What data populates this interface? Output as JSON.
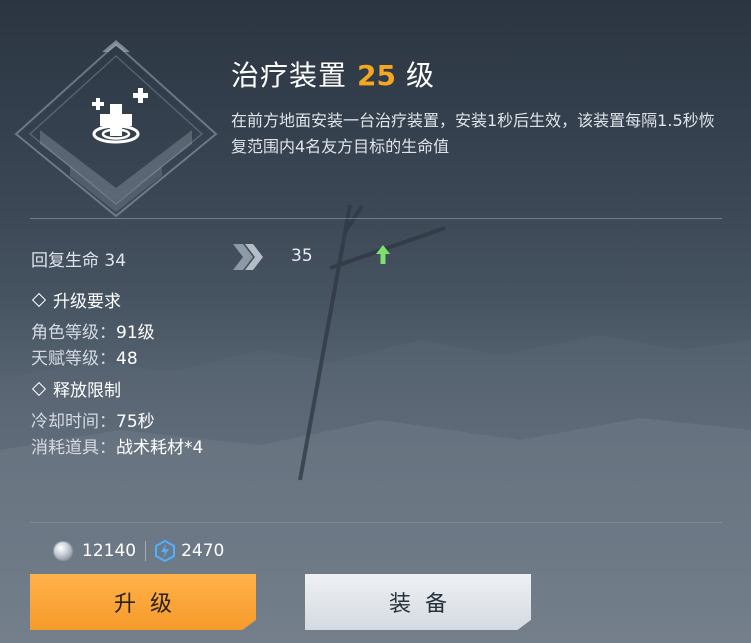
{
  "skill": {
    "name": "治疗装置",
    "level": "25",
    "level_suffix": "级",
    "description": "在前方地面安装一台治疗装置，安装1秒后生效，该装置每隔1.5秒恢复范围内4名友方目标的生命值",
    "icon": "healing-device-icon"
  },
  "stat": {
    "label": "回复生命 34",
    "next_value": "35"
  },
  "requirements": {
    "header": "升级要求",
    "items": [
      {
        "key": "角色等级：",
        "value": "91级"
      },
      {
        "key": "天赋等级：",
        "value": "48"
      }
    ]
  },
  "restrictions": {
    "header": "释放限制",
    "items": [
      {
        "key": "冷却时间：",
        "value": "75秒"
      },
      {
        "key": "消耗道具：",
        "value": "战术耗材*4"
      }
    ]
  },
  "currency": {
    "silver": "12140",
    "energy": "2470"
  },
  "buttons": {
    "upgrade": "升级",
    "equip": "装备"
  },
  "colors": {
    "level": "#f5a623",
    "upgrade_button": "#f69a2b",
    "up_arrow": "#7be36b"
  }
}
